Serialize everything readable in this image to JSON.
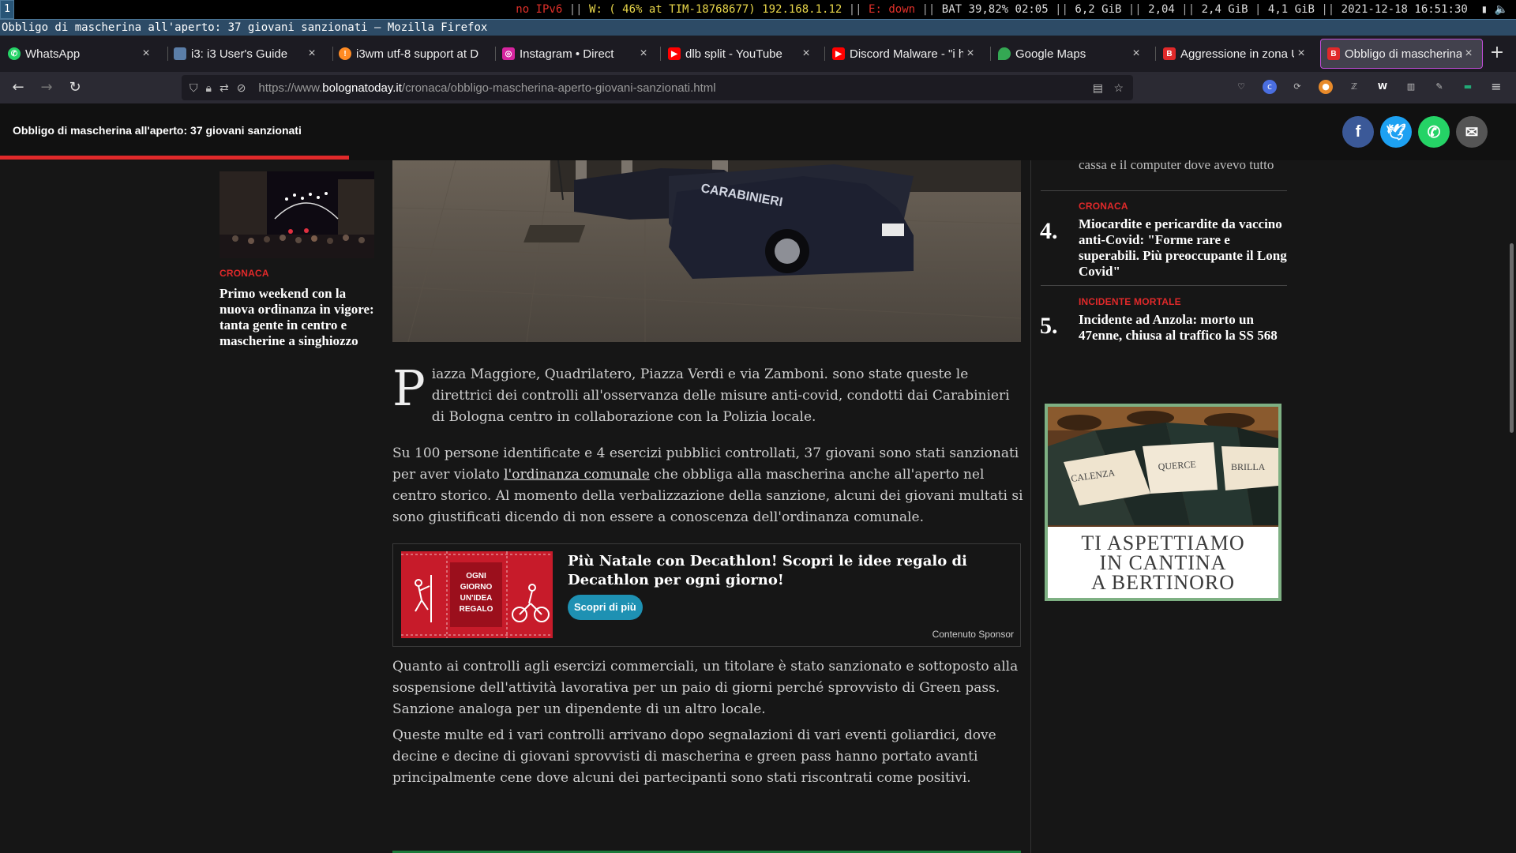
{
  "i3bar": {
    "workspace": "1",
    "ipv6": "no IPv6",
    "wifi": "W: ( 46% at TIM-18768677) 192.168.1.12",
    "ethernet": "E: down",
    "battery": "BAT 39,82% 02:05",
    "disk": "6,2 GiB",
    "load": "2,04",
    "mem_used": "2,4 GiB",
    "mem_avail": "4,1 GiB",
    "datetime": "2021-12-18 16:51:30"
  },
  "window_title": "Obbligo di mascherina all'aperto: 37 giovani sanzionati — Mozilla Firefox",
  "tabs": [
    {
      "label": "WhatsApp",
      "icon": "whatsapp-icon",
      "color": "#25d366"
    },
    {
      "label": "i3: i3 User's Guide",
      "icon": "i3-icon",
      "color": "#5b7ea8"
    },
    {
      "label": "i3wm utf-8 support at D",
      "icon": "reddit-icon",
      "color": "#ff8b24"
    },
    {
      "label": "Instagram • Direct",
      "icon": "instagram-icon",
      "color": "#d6249f"
    },
    {
      "label": "dlb split - YouTube",
      "icon": "youtube-icon",
      "color": "#ff0000"
    },
    {
      "label": "Discord Malware - \"i ha",
      "icon": "youtube-icon",
      "color": "#ff0000"
    },
    {
      "label": "Google Maps",
      "icon": "maps-pin-icon",
      "color": "#34a853"
    },
    {
      "label": "Aggressione in zona Un",
      "icon": "bolognatoday-icon",
      "color": "#e0292a"
    },
    {
      "label": "Obbligo di mascherina a",
      "icon": "bolognatoday-icon",
      "color": "#e0292a"
    }
  ],
  "url": {
    "scheme": "https://www.",
    "host": "bolognatoday.it",
    "path": "/cronaca/obbligo-mascherina-aperto-giovani-sanzionati.html"
  },
  "sticky": {
    "title": "Obbligo di mascherina all'aperto: 37 giovani sanzionati",
    "progress_fraction": 0.23
  },
  "left_related": {
    "kicker": "CRONACA",
    "headline": "Primo weekend con la nuova ordinanza in vigore: tanta gente in centro e mascherine a singhiozzo"
  },
  "hero": {
    "car_text": "CARABINIERI"
  },
  "article": {
    "dropcap": "P",
    "p1": "iazza Maggiore, Quadrilatero, Piazza Verdi e via Zamboni. sono state queste le direttrici dei controlli all'osservanza delle misure anti-covid, condotti dai Carabinieri di Bologna centro in collaborazione con la Polizia locale.",
    "p2_before": "Su 100 persone identificate e 4 esercizi pubblici controllati, 37 giovani sono stati sanzionati per aver violato ",
    "p2_link": "l'ordinanza comunale",
    "p2_after": " che obbliga alla mascherina anche all'aperto nel centro storico. Al momento della verbalizzazione della sanzione, alcuni dei giovani multati si sono giustificati dicendo di non essere a conoscenza dell'ordinanza comunale.",
    "p3": "Quanto ai controlli agli esercizi commerciali, un titolare è stato sanzionato e sottoposto alla sospensione dell'attività lavorativa per un paio di giorni perché sprovvisto di Green pass. Sanzione analoga per un dipendente di un altro locale.",
    "p4": "Queste multe ed i vari controlli arrivano dopo segnalazioni di vari eventi goliardici, dove decine e decine di giovani sprovvisti di mascherina e green pass hanno portato avanti principalmente cene dove alcuni dei partecipanti sono stati riscontrati come positivi."
  },
  "sponsor": {
    "image_text": [
      "OGNI",
      "GIORNO",
      "UN'IDEA",
      "REGALO"
    ],
    "title": "Più Natale con Decathlon! Scopri le idee regalo di Decathlon per ogni giorno!",
    "button": "Scopri di più",
    "label": "Contenuto Sponsor"
  },
  "right_list": {
    "cut_text": "cassa e il computer dove avevo tutto",
    "items": [
      {
        "rank": "4.",
        "kicker": "CRONACA",
        "headline": "Miocardite e pericardite da vaccino anti-Covid: \"Forme rare e superabili. Più preoccupante il Long Covid\""
      },
      {
        "rank": "5.",
        "kicker": "INCIDENTE MORTALE",
        "headline": "Incidente ad Anzola: morto un 47enne, chiusa al traffico la SS 568"
      }
    ]
  },
  "ad": {
    "bottles_text": [
      "CALENZA",
      "QUERCE",
      "BRILLA"
    ],
    "lines": [
      "TI ASPETTIAMO",
      "IN CANTINA",
      "A BERTINORO"
    ]
  },
  "colors": {
    "accent_red": "#e0292a",
    "tab_active_border": "#c04dd8",
    "button_teal": "#1e91b3"
  }
}
